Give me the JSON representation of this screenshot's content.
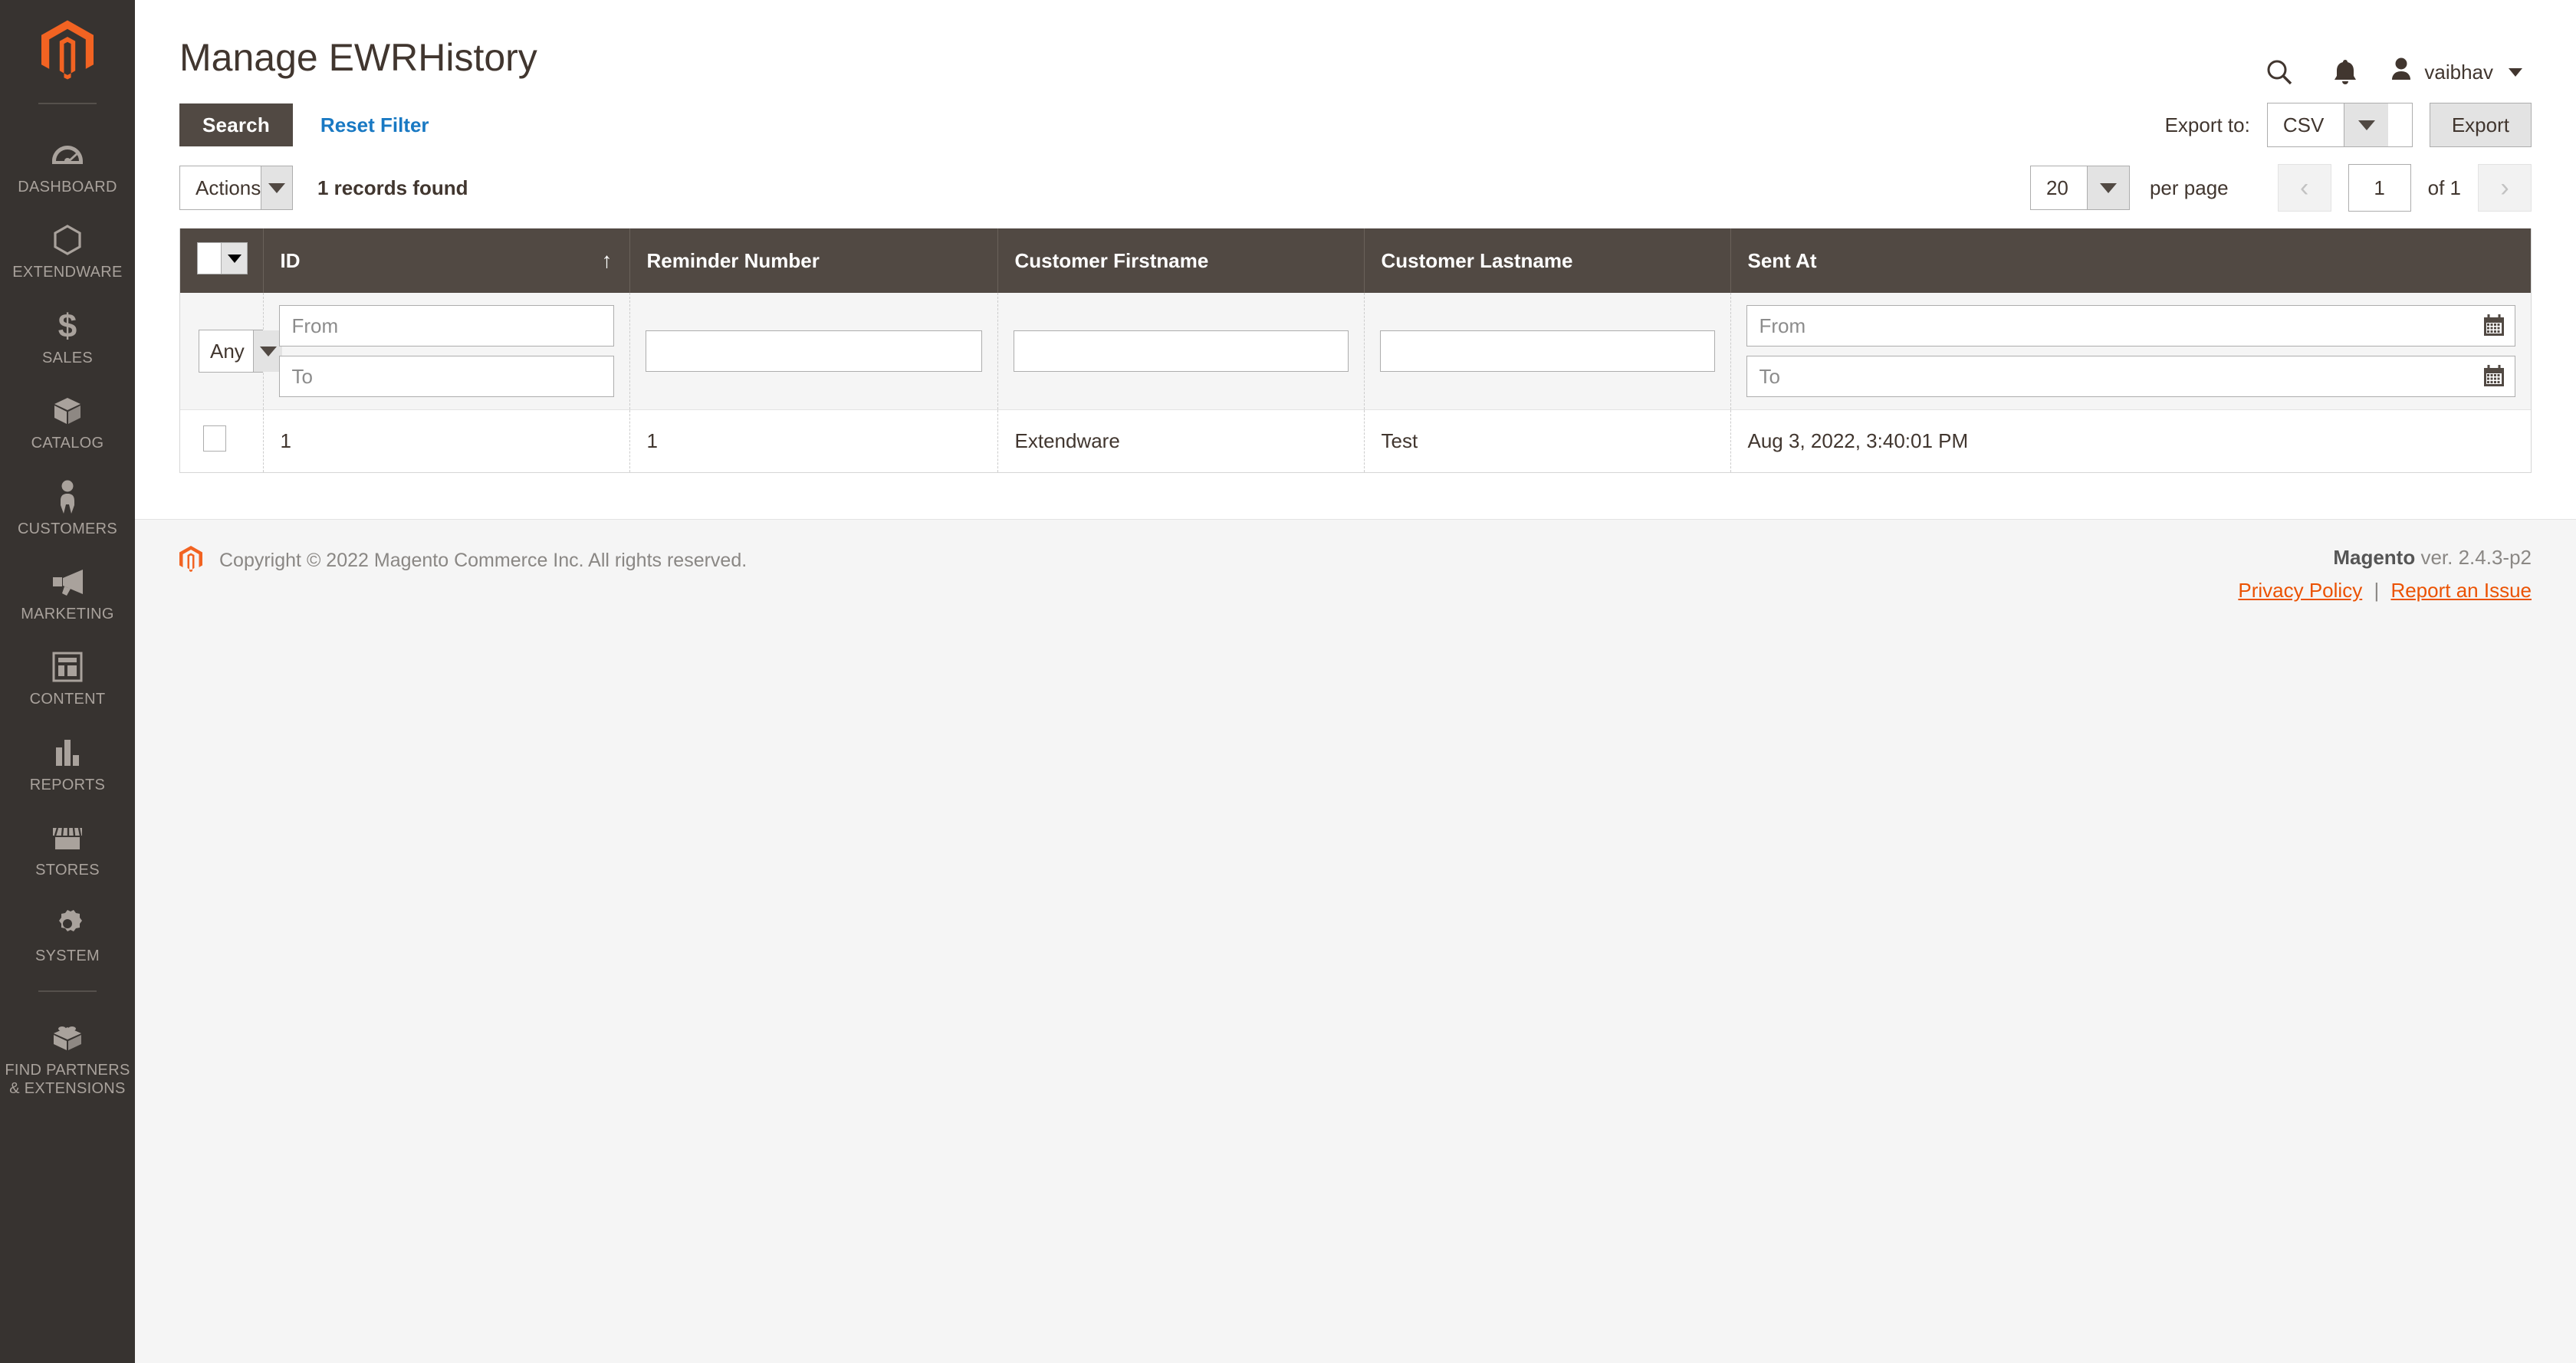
{
  "sidebar": {
    "logo": "magento-logo",
    "items": [
      {
        "label": "DASHBOARD",
        "icon": "dashboard-icon"
      },
      {
        "label": "EXTENDWARE",
        "icon": "hexagon-icon"
      },
      {
        "label": "SALES",
        "icon": "dollar-icon"
      },
      {
        "label": "CATALOG",
        "icon": "box-icon"
      },
      {
        "label": "CUSTOMERS",
        "icon": "person-icon"
      },
      {
        "label": "MARKETING",
        "icon": "megaphone-icon"
      },
      {
        "label": "CONTENT",
        "icon": "layout-icon"
      },
      {
        "label": "REPORTS",
        "icon": "bar-chart-icon"
      },
      {
        "label": "STORES",
        "icon": "storefront-icon"
      },
      {
        "label": "SYSTEM",
        "icon": "gear-icon"
      },
      {
        "label": "FIND PARTNERS\n& EXTENSIONS",
        "icon": "brick-icon"
      }
    ]
  },
  "header": {
    "title": "Manage EWRHistory",
    "search_icon": "search-icon",
    "notifications_icon": "bell-icon",
    "user_name": "vaibhav",
    "user_icon": "user-avatar-icon"
  },
  "toolbar": {
    "search_label": "Search",
    "reset_filter_label": "Reset Filter",
    "export_to_label": "Export to:",
    "export_format": "CSV",
    "export_button_label": "Export",
    "actions_label": "Actions",
    "records_found": "1 records found",
    "per_page_value": "20",
    "per_page_label": "per page",
    "prev_page_icon": "chevron-left-icon",
    "next_page_icon": "chevron-right-icon",
    "current_page": "1",
    "of_pages": "of 1"
  },
  "grid": {
    "columns": [
      {
        "key": "check",
        "label": ""
      },
      {
        "key": "id",
        "label": "ID",
        "sorted": "asc",
        "sort_icon": "arrow-up-icon"
      },
      {
        "key": "reminder",
        "label": "Reminder Number"
      },
      {
        "key": "firstname",
        "label": "Customer Firstname"
      },
      {
        "key": "lastname",
        "label": "Customer Lastname"
      },
      {
        "key": "sent_at",
        "label": "Sent At"
      }
    ],
    "filters": {
      "mass_select_value": "Any",
      "id_from_placeholder": "From",
      "id_to_placeholder": "To",
      "reminder_value": "",
      "firstname_value": "",
      "lastname_value": "",
      "sent_from_placeholder": "From",
      "sent_to_placeholder": "To",
      "calendar_icon": "calendar-icon"
    },
    "rows": [
      {
        "id": "1",
        "reminder": "1",
        "firstname": "Extendware",
        "lastname": "Test",
        "sent_at": "Aug 3, 2022, 3:40:01 PM"
      }
    ]
  },
  "footer": {
    "copyright": "Copyright © 2022 Magento Commerce Inc. All rights reserved.",
    "brand": "Magento",
    "version": " ver. 2.4.3-p2",
    "privacy_policy": "Privacy Policy",
    "separator": "|",
    "report_issue": "Report an Issue",
    "logo": "magento-logo-small"
  },
  "colors": {
    "sidebar_bg": "#373330",
    "brand_orange": "#eb5202",
    "header_dark": "#514943",
    "link_blue": "#1979c3"
  }
}
